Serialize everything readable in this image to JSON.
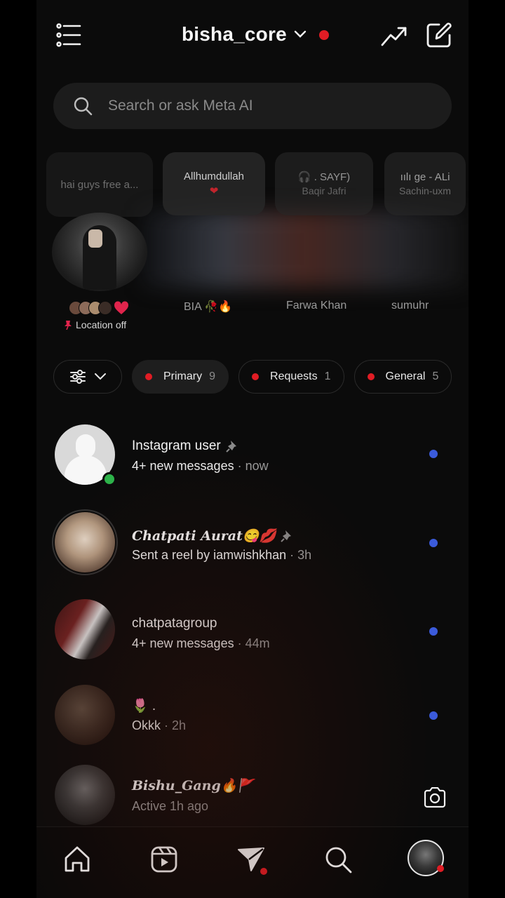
{
  "header": {
    "account_name": "bisha_core"
  },
  "search": {
    "placeholder": "Search or ask Meta AI"
  },
  "notes": [
    {
      "line1": "hai guys free a...",
      "line2": ""
    },
    {
      "line1": "Allhumdullah",
      "line2": ""
    },
    {
      "line1": "🎧 . SAYF)",
      "line2": "Baqir Jafri"
    },
    {
      "line1": "ıılı ge - ALi",
      "line2": "Sachin-uxm"
    }
  ],
  "stories": {
    "self_location": "Location off",
    "names": [
      "BIA 🥀🔥",
      "Farwa Khan",
      "sumuhr"
    ]
  },
  "tabs": {
    "primary": {
      "label": "Primary",
      "count": "9"
    },
    "requests": {
      "label": "Requests",
      "count": "1"
    },
    "general": {
      "label": "General",
      "count": "5"
    }
  },
  "messages": [
    {
      "title": "Instagram user",
      "preview": "4+ new messages",
      "time": "now",
      "unread": true,
      "pinned": true
    },
    {
      "title": "Chatpati Aurat😋💋",
      "preview": "Sent a reel by iamwishkhan",
      "time": "3h",
      "unread": true,
      "pinned": true
    },
    {
      "title": "chatpatagroup",
      "preview": "4+ new messages",
      "time": "44m",
      "unread": true,
      "pinned": false
    },
    {
      "title": "🌷 .",
      "preview": "Okkk",
      "time": "2h",
      "unread": true,
      "pinned": false
    },
    {
      "title": "Bishu_Gang🔥🚩",
      "preview": "Active 1h ago",
      "time": "",
      "unread": false,
      "pinned": false
    }
  ],
  "separator": "·",
  "icons": {
    "menu": "menu-list-icon",
    "chevron": "chevron-down-icon",
    "trend": "trending-icon",
    "compose": "compose-icon",
    "search": "search-icon",
    "filter": "filter-sliders-icon",
    "pin": "pin-icon",
    "camera": "camera-icon",
    "home": "home-icon",
    "reels": "reels-icon",
    "dm": "direct-message-icon",
    "explore": "search-icon",
    "profile": "profile-avatar"
  },
  "colors": {
    "background": "#0b0b0b",
    "accent_red": "#e01c24",
    "unread_blue": "#3b5bdb",
    "online_green": "#2db34a"
  }
}
